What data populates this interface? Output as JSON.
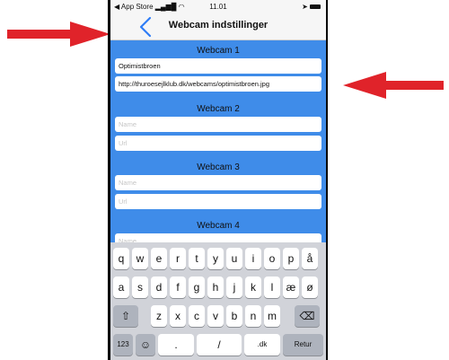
{
  "status_bar": {
    "back_app": "◀ App Store",
    "signal": "▂▄▆█",
    "wifi": "◠",
    "time": "11.01",
    "location": "➤"
  },
  "nav": {
    "back_icon": "chevron-left",
    "title": "Webcam indstillinger"
  },
  "webcams": [
    {
      "title": "Webcam 1",
      "name_value": "Optimistbroen",
      "url_value": "http://thuroesejlklub.dk/webcams/optimistbroen.jpg",
      "name_placeholder": "Name",
      "url_placeholder": "Url"
    },
    {
      "title": "Webcam 2",
      "name_value": "",
      "url_value": "",
      "name_placeholder": "Name",
      "url_placeholder": "Url"
    },
    {
      "title": "Webcam 3",
      "name_value": "",
      "url_value": "",
      "name_placeholder": "Name",
      "url_placeholder": "Url"
    },
    {
      "title": "Webcam 4",
      "name_value": "",
      "name_placeholder": "Name"
    }
  ],
  "keyboard": {
    "row1": [
      "q",
      "w",
      "e",
      "r",
      "t",
      "y",
      "u",
      "i",
      "o",
      "p",
      "å"
    ],
    "row2": [
      "a",
      "s",
      "d",
      "f",
      "g",
      "h",
      "j",
      "k",
      "l",
      "æ",
      "ø"
    ],
    "row3": [
      "z",
      "x",
      "c",
      "v",
      "b",
      "n",
      "m"
    ],
    "shift": "⇧",
    "delete": "⌫",
    "numbers": "123",
    "emoji": "☺",
    "dot": ".",
    "slash": "/",
    "dk": ".dk",
    "return": "Retur"
  },
  "colors": {
    "content_bg": "#3f8ce9",
    "arrow": "#e0232a",
    "back_chevron": "#2f7df6",
    "keyboard_bg": "#d1d3d9"
  }
}
